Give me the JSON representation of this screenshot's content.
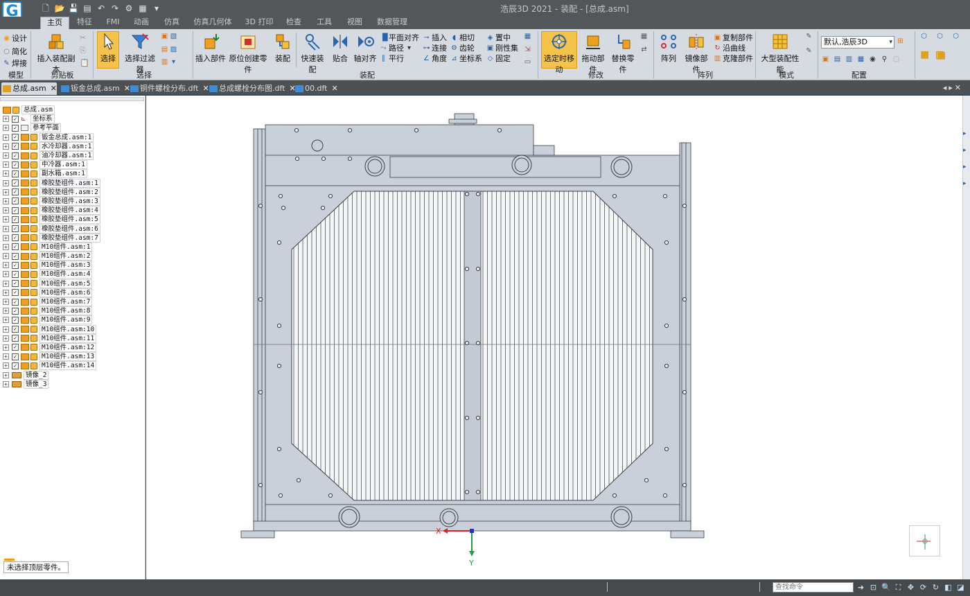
{
  "title": "浩辰3D 2021 - 装配 - [总成.asm]",
  "logo_letter": "G",
  "qat_icons": [
    "new-icon",
    "open-icon",
    "save-icon",
    "saveas-icon",
    "undo-icon",
    "redo-icon",
    "options-icon",
    "layers-icon",
    "more-icon"
  ],
  "ribbon_tabs": [
    "主页",
    "特征",
    "FMI",
    "动画",
    "仿真",
    "仿真几何体",
    "3D 打印",
    "检查",
    "工具",
    "视图",
    "数据管理"
  ],
  "ribbon": {
    "model": {
      "items": [
        "设计",
        "简化",
        "焊接"
      ],
      "group": "模型"
    },
    "clipboard": {
      "insert_copy": "插入装配副本",
      "group": "剪贴板"
    },
    "select": {
      "select": "选择",
      "filter": "选择过滤器",
      "group": "选择"
    },
    "assemble": {
      "insert_part": "插入部件",
      "create_in_place": "原位创建零件",
      "assemble": "装配",
      "quick_assemble": "快速装配",
      "mate": "贴合",
      "axial_align": "轴对齐",
      "col1": [
        "平面对齐",
        "路径",
        "平行"
      ],
      "col2": [
        "插入",
        "连接",
        "角度"
      ],
      "col3": [
        "相切",
        "齿轮",
        "坐标系"
      ],
      "col4": [
        "置中",
        "刚性集",
        "固定"
      ],
      "group": "装配"
    },
    "modify": {
      "move_on_select": "选定时移动",
      "drag_part": "拖动部件",
      "replace_part": "替换零件",
      "group": "修改"
    },
    "pattern": {
      "pattern": "阵列",
      "mirror_part": "镜像部件",
      "smalls": [
        "复制部件",
        "沿曲线",
        "克隆部件"
      ],
      "group": "阵列"
    },
    "mode": {
      "large_assembly": "大型装配性能",
      "group": "模式"
    },
    "config": {
      "combo_value": "默认,浩辰3D",
      "group": "配置"
    }
  },
  "doc_tabs": [
    "总成.asm",
    "钣金总成.asm",
    "铜件螺栓分布.dft",
    "总成螺栓分布图.dft",
    "00.dft"
  ],
  "tree": {
    "root": "总成.asm",
    "items": [
      {
        "label": "坐标系",
        "kind": "coord"
      },
      {
        "label": "参考平面",
        "kind": "plane"
      },
      {
        "label": "钣金总成.asm:1",
        "kind": "part"
      },
      {
        "label": "水冷却器.asm:1",
        "kind": "part"
      },
      {
        "label": "油冷却器.asm:1",
        "kind": "part"
      },
      {
        "label": "中冷器.asm:1",
        "kind": "part"
      },
      {
        "label": "副水箱.asm:1",
        "kind": "part"
      },
      {
        "label": "橡胶垫组件.asm:1",
        "kind": "part"
      },
      {
        "label": "橡胶垫组件.asm:2",
        "kind": "part"
      },
      {
        "label": "橡胶垫组件.asm:3",
        "kind": "part"
      },
      {
        "label": "橡胶垫组件.asm:4",
        "kind": "part"
      },
      {
        "label": "橡胶垫组件.asm:5",
        "kind": "part"
      },
      {
        "label": "橡胶垫组件.asm:6",
        "kind": "part"
      },
      {
        "label": "橡胶垫组件.asm:7",
        "kind": "part"
      },
      {
        "label": "M10组件.asm:1",
        "kind": "part"
      },
      {
        "label": "M10组件.asm:2",
        "kind": "part"
      },
      {
        "label": "M10组件.asm:3",
        "kind": "part"
      },
      {
        "label": "M10组件.asm:4",
        "kind": "part"
      },
      {
        "label": "M10组件.asm:5",
        "kind": "part"
      },
      {
        "label": "M10组件.asm:6",
        "kind": "part"
      },
      {
        "label": "M10组件.asm:7",
        "kind": "part"
      },
      {
        "label": "M10组件.asm:8",
        "kind": "part"
      },
      {
        "label": "M10组件.asm:9",
        "kind": "part"
      },
      {
        "label": "M10组件.asm:10",
        "kind": "part"
      },
      {
        "label": "M10组件.asm:11",
        "kind": "part"
      },
      {
        "label": "M10组件.asm:12",
        "kind": "part"
      },
      {
        "label": "M10组件.asm:13",
        "kind": "part"
      },
      {
        "label": "M10组件.asm:14",
        "kind": "part"
      }
    ],
    "mirrors": [
      "镜像_2",
      "镜像_3"
    ]
  },
  "status_message": "未选择顶层零件。",
  "axis_labels": {
    "x": "X",
    "y": "Y"
  },
  "command_search_placeholder": "查找命令",
  "colors": {
    "accent": "#f6c34a",
    "model_fill": "#c9d0d9",
    "model_line": "#3a3f45",
    "axis_x": "#e02020",
    "axis_y": "#20a040",
    "axis_z": "#2030d0"
  }
}
